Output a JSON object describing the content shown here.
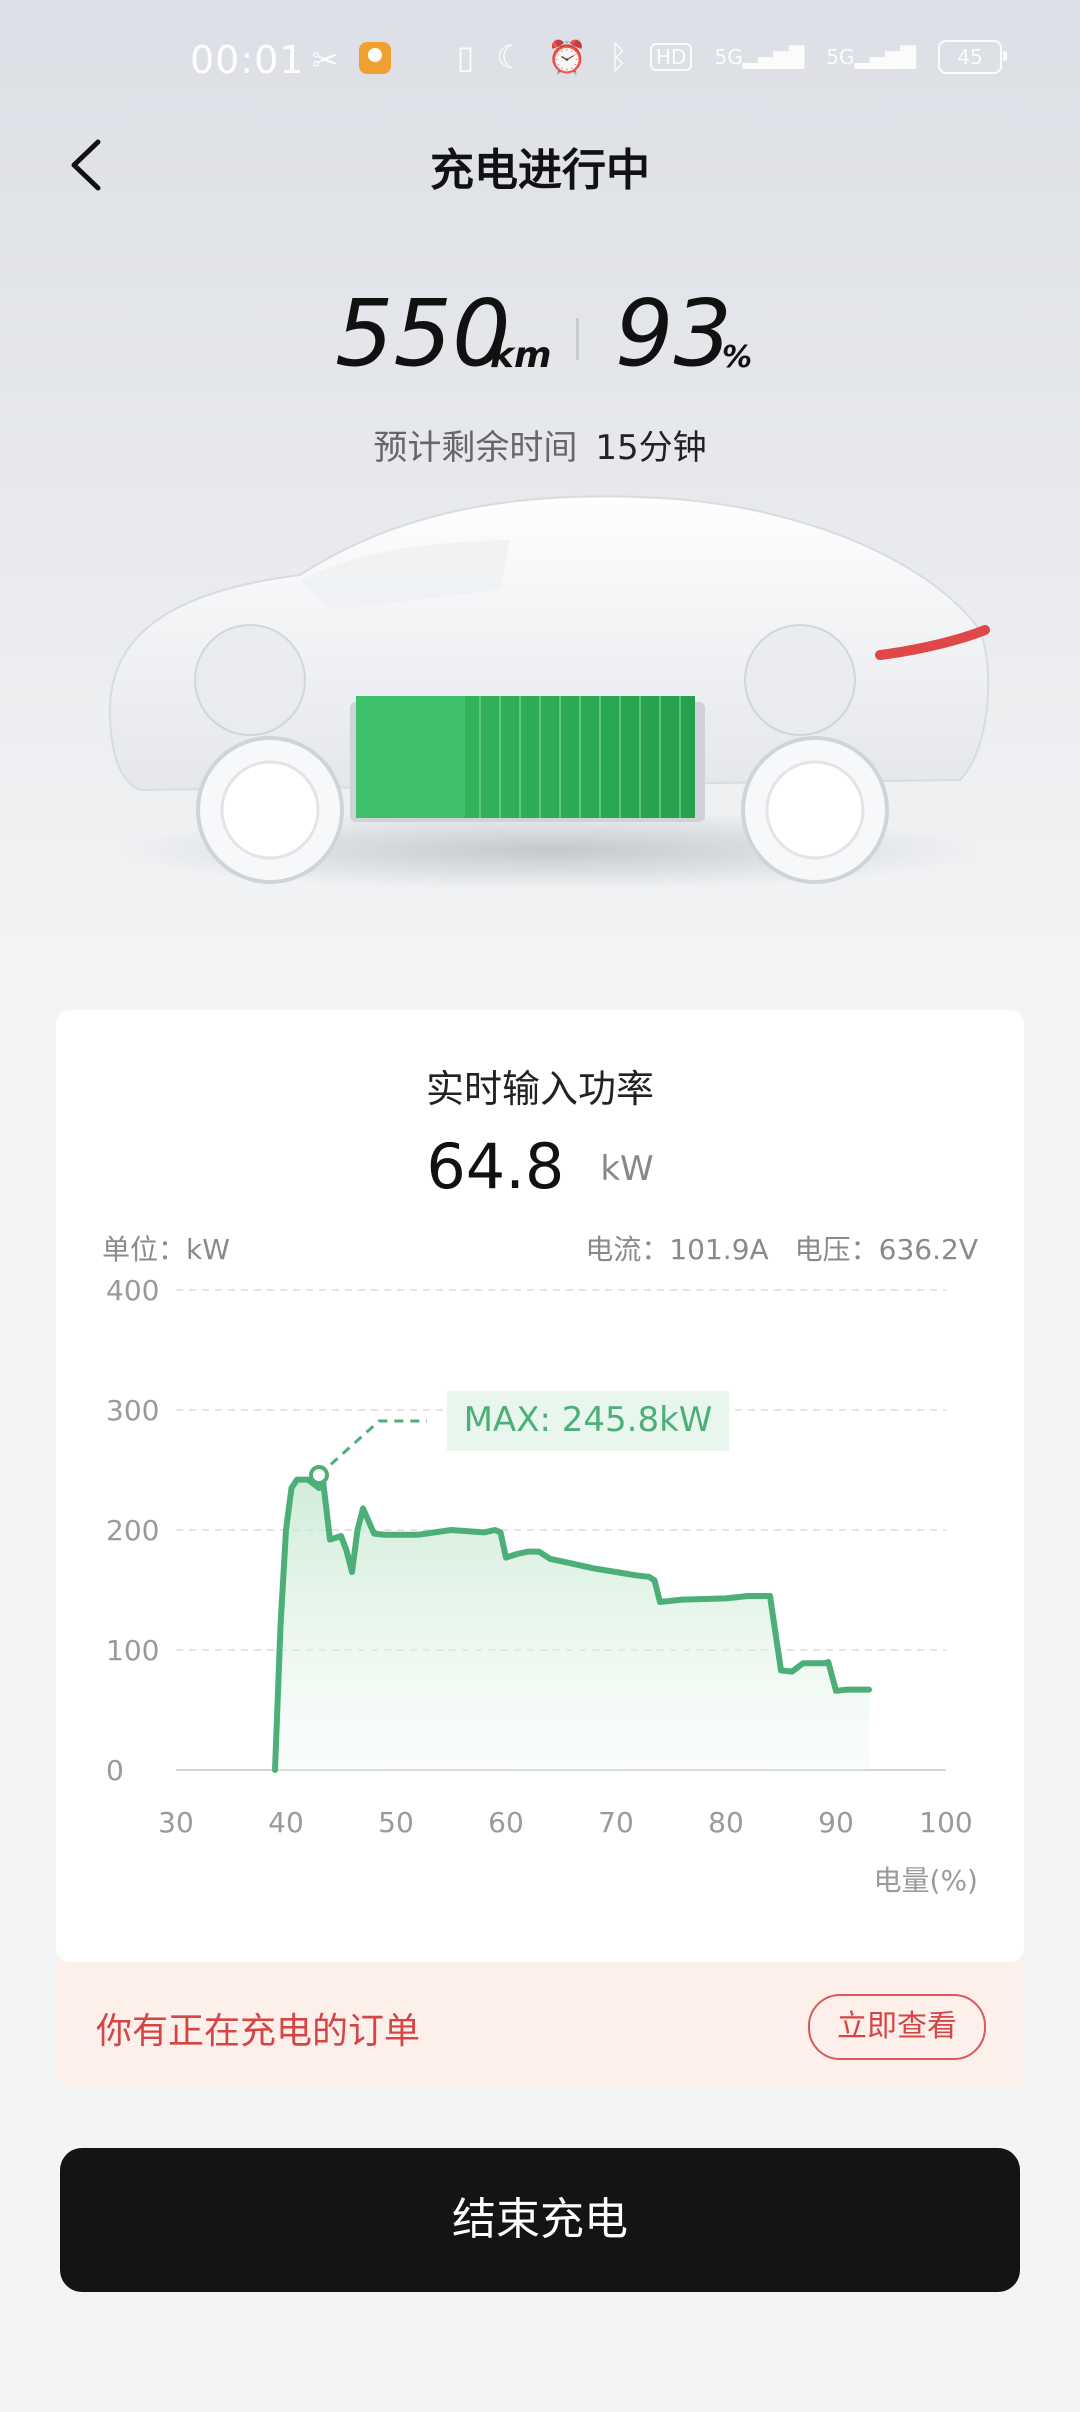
{
  "status_bar": {
    "time": "00:01",
    "left_icons": [
      "scissors-icon",
      "app-notification-icon"
    ],
    "right_icons": [
      "nfc-icon",
      "moon-icon",
      "alarm-icon",
      "bluetooth-icon"
    ],
    "hd_label": "HD",
    "signal_label": "5G",
    "battery": "45"
  },
  "header": {
    "title": "充电进行中",
    "back_icon": "chevron-left-icon"
  },
  "summary": {
    "range_value": "550",
    "range_unit": "km",
    "soc_value": "93",
    "soc_unit": "%",
    "remaining_label": "预计剩余时间",
    "remaining_value": "15分钟"
  },
  "power_card": {
    "title": "实时输入功率",
    "power_value": "64.8",
    "power_unit": "kW",
    "unit_label": "单位：kW",
    "current_label": "电流：101.9A",
    "voltage_label": "电压：636.2V",
    "max_label": "MAX: 245.8kW",
    "x_axis_title": "电量(%)"
  },
  "chart_data": {
    "type": "area",
    "title": "实时输入功率",
    "ylabel": "单位：kW",
    "xlabel": "电量(%)",
    "xlim": [
      30,
      100
    ],
    "ylim": [
      0,
      400
    ],
    "x_ticks": [
      30,
      40,
      50,
      60,
      70,
      80,
      90,
      100
    ],
    "y_ticks": [
      0,
      100,
      200,
      300,
      400
    ],
    "grid": true,
    "color": "#4caf78",
    "annotation": {
      "text": "MAX: 245.8kW",
      "x": 43,
      "y": 245.8
    },
    "series": [
      {
        "x": [
          39,
          39.5,
          40,
          40.5,
          41,
          42,
          43,
          43.3,
          44,
          45,
          45.5,
          46,
          46.5,
          47,
          48,
          49,
          50,
          52,
          55,
          58,
          59,
          59.5,
          60,
          61,
          62,
          63,
          64,
          66,
          68,
          70,
          72,
          73,
          73.5,
          74,
          76,
          80,
          82,
          83.5,
          84,
          85,
          86,
          87,
          88,
          89,
          89.3,
          90,
          91,
          93
        ],
        "y": [
          0,
          120,
          200,
          235,
          242,
          242,
          235,
          245.8,
          192,
          195,
          183,
          165,
          200,
          218,
          197,
          196,
          196,
          196,
          200,
          198,
          200,
          198,
          177,
          180,
          182,
          182,
          176,
          172,
          168,
          165,
          162,
          161,
          158,
          140,
          142,
          143,
          145,
          145,
          145,
          83,
          82,
          89,
          89,
          89,
          90,
          66,
          67,
          67
        ]
      }
    ]
  },
  "order_banner": {
    "text": "你有正在充电的订单",
    "button_label": "立即查看"
  },
  "end_button": {
    "label": "结束充电"
  }
}
